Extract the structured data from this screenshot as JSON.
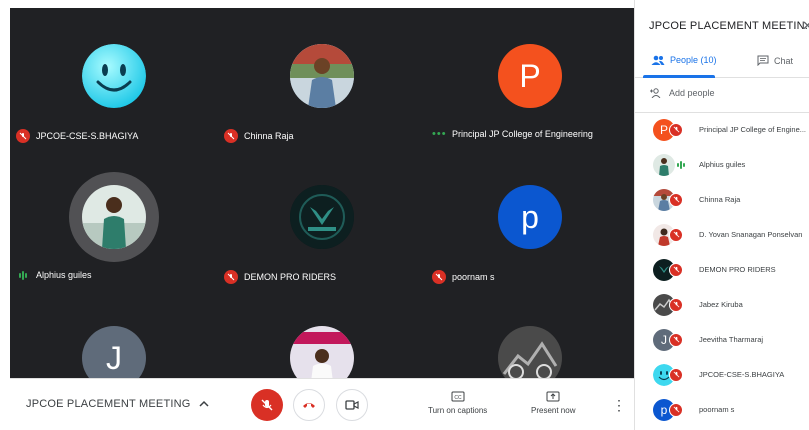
{
  "tiles": [
    {
      "name": "JPCOE-CSE-S.BHAGIYA",
      "avatar": "smiley-icon",
      "status": "muted"
    },
    {
      "name": "Chinna Raja",
      "avatar": "photo-man-outdoor",
      "status": "muted"
    },
    {
      "name": "Principal JP College of Engineering",
      "avatar_letter": "P",
      "avatar_color": "#f4511e",
      "status": "dots"
    },
    {
      "name": "Alphius guiles",
      "avatar": "photo-man-standing",
      "status": "speaking"
    },
    {
      "name": "DEMON PRO RIDERS",
      "avatar": "logo-demon",
      "status": "muted"
    },
    {
      "name": "poornam s",
      "avatar_letter": "p",
      "avatar_color": "#0b57d0",
      "status": "muted"
    },
    {
      "avatar_letter": "J",
      "avatar_color": "#5f6b7a"
    },
    {
      "avatar": "photo-man-banner"
    },
    {
      "avatar": "photo-moto"
    }
  ],
  "bottom_bar": {
    "meeting_title": "JPCOE PLACEMENT MEETING",
    "captions_label": "Turn on captions",
    "present_label": "Present now"
  },
  "panel": {
    "title": "JPCOE PLACEMENT MEETIN...",
    "tab_people": "People (10)",
    "tab_chat": "Chat",
    "add_people": "Add people",
    "participants": [
      {
        "name": "Principal JP College of Engine...",
        "letter": "P",
        "color": "#f4511e",
        "status": "muted"
      },
      {
        "name": "Alphius guiles",
        "photo": "photo-man-standing",
        "status": "speaking"
      },
      {
        "name": "Chinna Raja",
        "photo": "photo-man-outdoor",
        "status": "muted"
      },
      {
        "name": "D. Yovan Snanagan Ponselvan",
        "photo": "photo-person",
        "status": "muted"
      },
      {
        "name": "DEMON PRO RIDERS",
        "photo": "logo-demon",
        "status": "muted"
      },
      {
        "name": "Jabez Kiruba",
        "photo": "photo-moto",
        "status": "muted"
      },
      {
        "name": "Jeevitha Tharmaraj",
        "letter": "J",
        "color": "#5f6b7a",
        "status": "muted"
      },
      {
        "name": "JPCOE-CSE-S.BHAGIYA",
        "photo": "smiley-icon",
        "status": "muted"
      },
      {
        "name": "poornam s",
        "letter": "p",
        "color": "#0b57d0",
        "status": "muted"
      }
    ]
  },
  "colors": {
    "stage_bg": "#202124",
    "mute_red": "#d93025",
    "accent_blue": "#1a73e8",
    "speaking_green": "#34a853"
  }
}
